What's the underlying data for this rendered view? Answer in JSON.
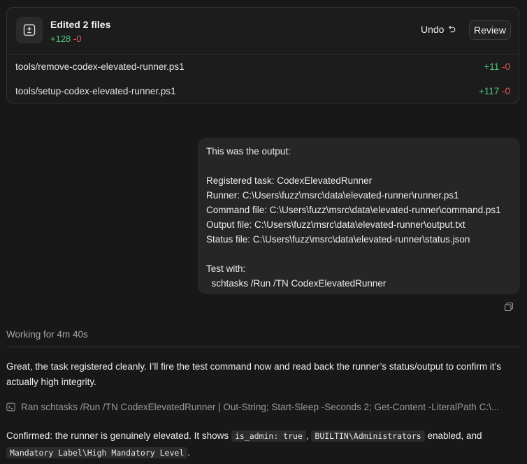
{
  "edit_summary": {
    "title": "Edited 2 files",
    "added": "+128",
    "removed": "-0",
    "undo_label": "Undo",
    "review_label": "Review",
    "files": [
      {
        "path": "tools/remove-codex-elevated-runner.ps1",
        "added": "+11",
        "removed": "-0"
      },
      {
        "path": "tools/setup-codex-elevated-runner.ps1",
        "added": "+117",
        "removed": "-0"
      }
    ]
  },
  "user_message": {
    "lines": [
      "This was the output:",
      "",
      "Registered task: CodexElevatedRunner",
      "Runner: C:\\Users\\fuzz\\msrc\\data\\elevated-runner\\runner.ps1",
      "Command file: C:\\Users\\fuzz\\msrc\\data\\elevated-runner\\command.ps1",
      "Output file: C:\\Users\\fuzz\\msrc\\data\\elevated-runner\\output.txt",
      "Status file: C:\\Users\\fuzz\\msrc\\data\\elevated-runner\\status.json",
      "",
      "Test with:",
      "  schtasks /Run /TN CodexElevatedRunner"
    ]
  },
  "working_status": "Working for 4m 40s",
  "assistant": {
    "message": "Great, the task registered cleanly. I’ll fire the test command now and read back the runner’s status/output to confirm it’s actually high integrity.",
    "ran_command": "Ran schtasks /Run /TN CodexElevatedRunner | Out-String; Start-Sleep -Seconds 2; Get-Content -LiteralPath C:\\...",
    "confirm": {
      "prefix": "Confirmed: the runner is genuinely elevated. It shows ",
      "code1": "is_admin: true",
      "sep1": ", ",
      "code2": "BUILTIN\\Administrators",
      "mid": " enabled, and ",
      "code3": "Mandatory Label\\High Mandatory Level",
      "suffix": "."
    }
  },
  "colors": {
    "added": "#4fc27f",
    "removed": "#e55a5a",
    "background": "#181818"
  },
  "icons": {
    "edit_badge": "plus-minus-icon",
    "undo": "undo-icon",
    "copy": "copy-icon",
    "terminal": "terminal-icon"
  }
}
